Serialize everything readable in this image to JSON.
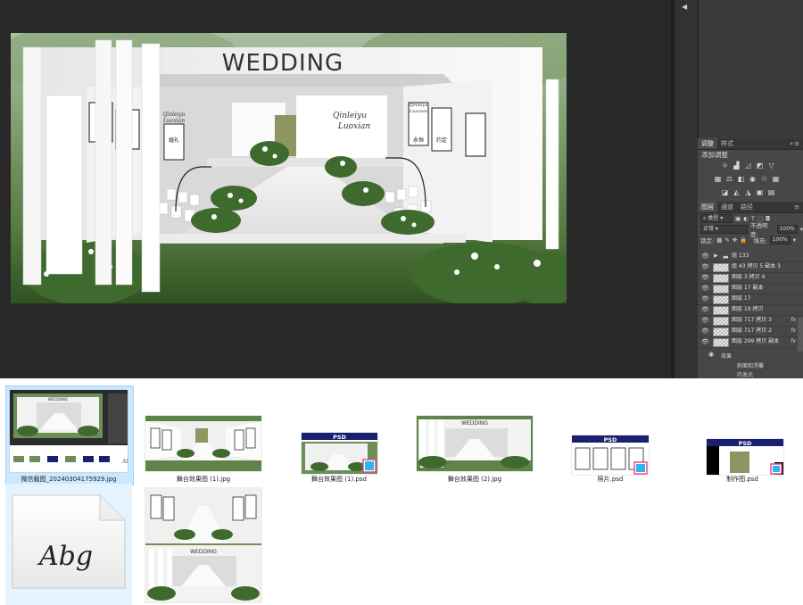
{
  "canvas": {
    "headline": "WEDDING",
    "left_sign": {
      "script_top": "Qinleiyu",
      "script_bottom": "Luoxian"
    },
    "right_sign": {
      "script_top": "Qinleiyu",
      "script_bottom": "Luoxian"
    },
    "panel_text": {
      "left": "婚礼",
      "right_a": "永恒",
      "right_b": "约定"
    }
  },
  "adjustments": {
    "tabs": [
      "调整",
      "样式"
    ],
    "title": "添加调整"
  },
  "layers": {
    "tabs": [
      "图层",
      "通道",
      "路径"
    ],
    "filter_kind": "类型",
    "blend_mode": "正常",
    "opacity_label": "不透明度:",
    "opacity_value": "100%",
    "lock_label": "锁定:",
    "fill_label": "填充:",
    "fill_value": "100%",
    "items": [
      {
        "name": "组 133",
        "type": "group",
        "fx": ""
      },
      {
        "name": "组 43 拷贝 5 副本 3",
        "type": "layer",
        "fx": ""
      },
      {
        "name": "图层 3 拷贝 4",
        "type": "layer",
        "fx": ""
      },
      {
        "name": "图层 17 副本",
        "type": "layer",
        "fx": ""
      },
      {
        "name": "图层 17",
        "type": "layer",
        "fx": ""
      },
      {
        "name": "图层 19 拷贝",
        "type": "layer",
        "fx": ""
      },
      {
        "name": "图层 717 拷贝 3",
        "type": "layer",
        "fx": "fx"
      },
      {
        "name": "图层 717 拷贝 2",
        "type": "layer",
        "fx": "fx"
      },
      {
        "name": "图层 299 拷贝 副本",
        "type": "layer",
        "fx": "fx"
      }
    ],
    "effects_label": "效果",
    "effects": [
      "斜面和浮雕",
      "内发光"
    ]
  },
  "files": [
    {
      "name": "微信截图_20240304175929.jpg",
      "selected": true
    },
    {
      "name": "舞台效果图 (1).jpg",
      "selected": false
    },
    {
      "name": "舞台效果图 (1).psd",
      "selected": false
    },
    {
      "name": "舞台效果图 (2).jpg",
      "selected": false
    },
    {
      "name": "照片.psd",
      "selected": false
    },
    {
      "name": "制作图.psd",
      "selected": false
    }
  ],
  "psd_badge": "PSD",
  "font_preview": "Abg",
  "mini_headline": "WEDDING",
  "colors": {
    "psd_header": "#1a1f6e",
    "foliage": "#3f6a2e",
    "ps_bg": "#282828",
    "selection": "#cce8ff"
  }
}
